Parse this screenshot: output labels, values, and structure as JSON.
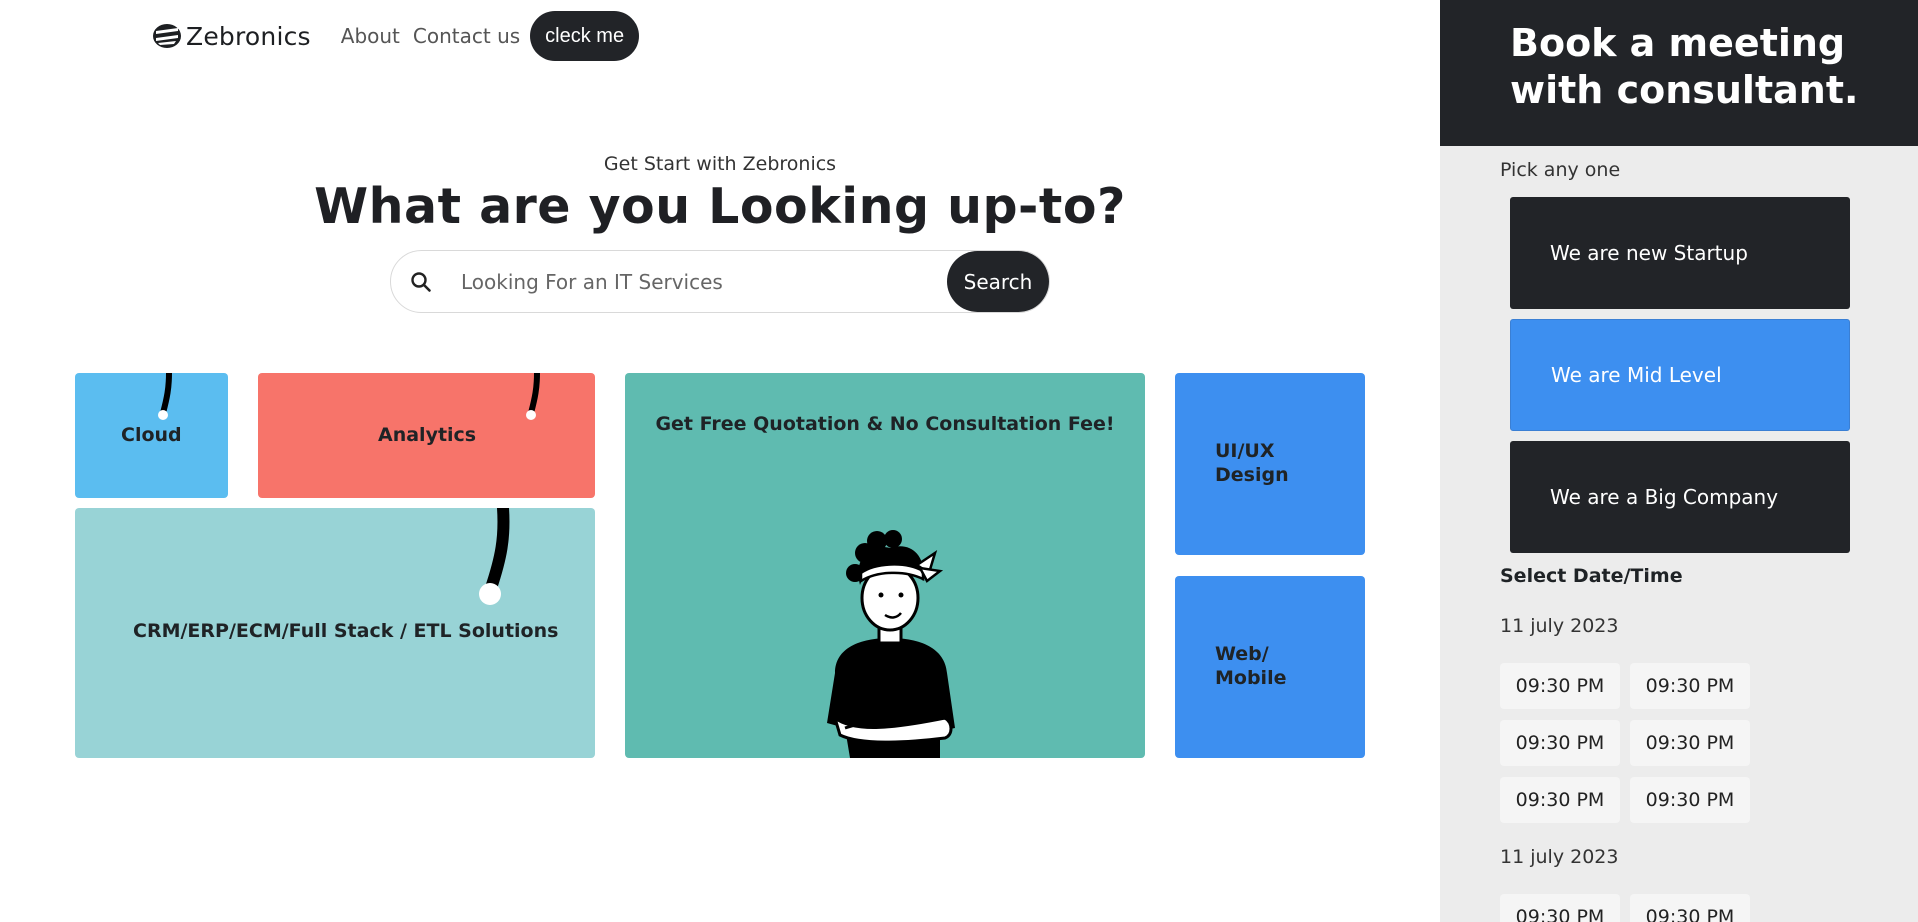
{
  "nav": {
    "brand": "Zebronics",
    "links": [
      "About",
      "Contact us"
    ],
    "cta": "cleck me"
  },
  "hero": {
    "subtitle": "Get Start with Zebronics",
    "title": "What are you Looking up-to?",
    "search_placeholder": "Looking For an IT Services",
    "search_button": "Search"
  },
  "tiles": {
    "cloud": "Cloud",
    "analytics": "Analytics",
    "crm": "CRM/ERP/ECM/Full Stack / ETL Solutions",
    "quote": "Get Free Quotation & No Consultation Fee!",
    "uiux": "UI/UX Design",
    "web": "Web/ Mobile"
  },
  "sidebar": {
    "title": "Book a meeting with consultant.",
    "pick_label": "Pick any one",
    "options": [
      "We are new Startup",
      "We are Mid Level",
      "We are a Big Company"
    ],
    "selected_option": "We are Mid Level",
    "datetime_label": "Select Date/Time",
    "dates": [
      {
        "date": "11 july 2023",
        "slots": [
          "09:30 PM",
          "09:30 PM",
          "09:30 PM",
          "09:30 PM",
          "09:30 PM",
          "09:30 PM"
        ]
      },
      {
        "date": "11 july 2023",
        "slots": [
          "09:30 PM",
          "09:30 PM"
        ]
      }
    ]
  },
  "colors": {
    "dark": "#222428",
    "cloud": "#5bbdf0",
    "analytics": "#f7746a",
    "crm": "#98d3d6",
    "quote": "#5fbbb0",
    "blue": "#3d8ff0"
  }
}
